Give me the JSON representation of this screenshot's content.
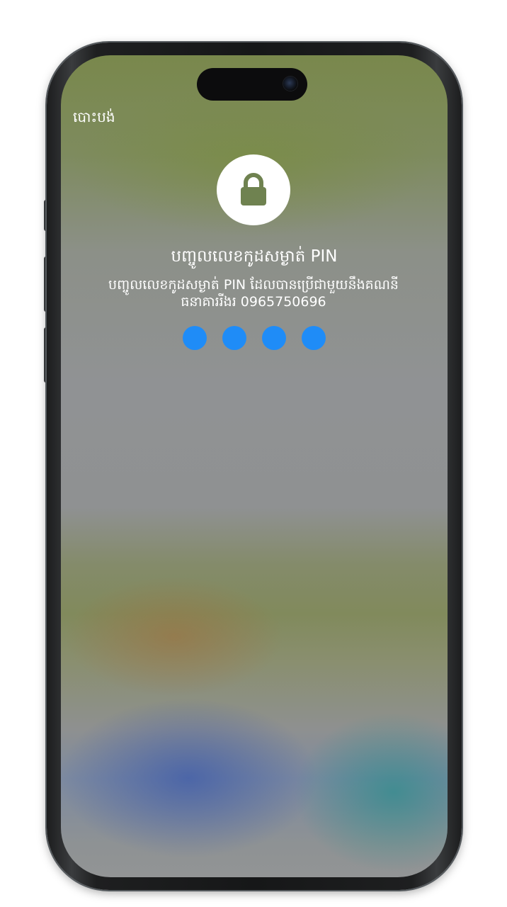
{
  "header": {
    "cancel_label": "បោះបង់"
  },
  "pin_prompt": {
    "title": "បញ្ចូលលេខកូដសម្ងាត់ PIN",
    "subtitle_line1": "បញ្ចូលលេខកូដសម្ងាត់ PIN ដែលបានប្រើជាមួយនឹងគណនី",
    "subtitle_line2": "ធនាគាររីងរ 0965750696",
    "lock_icon": "lock-icon",
    "pin_length": 4,
    "digits_entered": 4
  },
  "colors": {
    "pin_dot": "#1f8cf7",
    "lock_badge": "#ffffff",
    "lock_glyph": "#6f8250"
  }
}
